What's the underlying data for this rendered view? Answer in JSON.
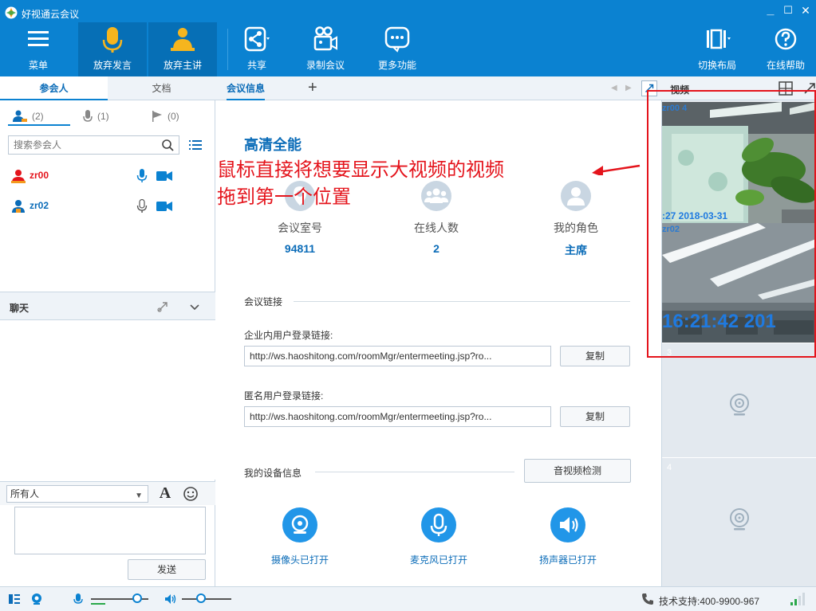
{
  "window": {
    "title": "好视通云会议",
    "minimize": "_",
    "close": "✕"
  },
  "toolbar": {
    "menu": "菜单",
    "give_up_speaking": "放弃发言",
    "give_up_presenter": "放弃主讲",
    "share": "共享",
    "record": "录制会议",
    "more": "更多功能",
    "layout": "切换布局",
    "help": "在线帮助"
  },
  "left": {
    "tabs": [
      "参会人",
      "文档"
    ],
    "filters": [
      "(2)",
      "(1)",
      "(0)"
    ],
    "search_placeholder": "搜索参会人",
    "members": [
      {
        "name": "zr00",
        "color": "#e4141c"
      },
      {
        "name": "zr02",
        "color": "#0b6cb8"
      }
    ],
    "chat_title": "聊天",
    "recipient": "所有人",
    "font_button": "A",
    "send": "发送"
  },
  "center": {
    "tab": "会议信息",
    "add": "+",
    "meeting_title": "高清全能",
    "annotation_line1": "鼠标直接将想要显示大视频的视频",
    "annotation_line2": "拖到第一个位置",
    "stats": [
      {
        "label": "会议室号",
        "value": "94811"
      },
      {
        "label": "在线人数",
        "value": "2"
      },
      {
        "label": "我的角色",
        "value": "主席"
      }
    ],
    "link_section": "会议链接",
    "internal_label": "企业内用户登录链接:",
    "internal_link": "http://ws.haoshitong.com/roomMgr/entermeeting.jsp?ro...",
    "anon_label": "匿名用户登录链接:",
    "anon_link": "http://ws.haoshitong.com/roomMgr/entermeeting.jsp?ro...",
    "copy": "复制",
    "device_section": "我的设备信息",
    "av_test": "音视频检测",
    "devices": [
      "摄像头已打开",
      "麦克风已打开",
      "扬声器已打开"
    ]
  },
  "video": {
    "title": "视频",
    "tiles": [
      {
        "label": "zr00 4",
        "time": ":27 2018-03-31"
      },
      {
        "label": "zr02",
        "time": "16:21:42 201"
      }
    ],
    "empty_tiles": [
      "3",
      "4"
    ]
  },
  "status": {
    "support": "技术支持:400-9900-967"
  },
  "colors": {
    "primary": "#0b82d1",
    "accent_text": "#0b6cb8",
    "annotation": "#e4141c"
  }
}
